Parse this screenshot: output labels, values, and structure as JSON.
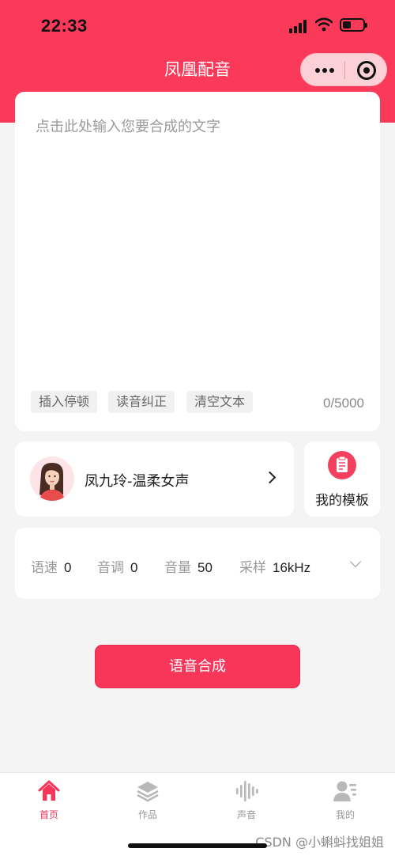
{
  "status_bar": {
    "time": "22:33"
  },
  "nav": {
    "title": "凤凰配音"
  },
  "editor": {
    "placeholder": "点击此处输入您要合成的文字",
    "chips": [
      "插入停顿",
      "读音纠正",
      "清空文本"
    ],
    "counter": "0/5000"
  },
  "voice": {
    "name": "凤九玲-温柔女声"
  },
  "template": {
    "label": "我的模板"
  },
  "params": [
    {
      "label": "语速",
      "value": "0"
    },
    {
      "label": "音调",
      "value": "0"
    },
    {
      "label": "音量",
      "value": "50"
    },
    {
      "label": "采样",
      "value": "16kHz"
    }
  ],
  "synth_button": "语音合成",
  "tabs": [
    {
      "label": "首页",
      "icon": "home-icon",
      "active": true
    },
    {
      "label": "作品",
      "icon": "layers-icon",
      "active": false
    },
    {
      "label": "声音",
      "icon": "waveform-icon",
      "active": false
    },
    {
      "label": "我的",
      "icon": "profile-icon",
      "active": false
    }
  ],
  "watermark": "CSDN @小蝌蚪找姐姐",
  "colors": {
    "brand": "#fb3a5a",
    "button": "#f7365a",
    "background": "#f4f4f4"
  }
}
